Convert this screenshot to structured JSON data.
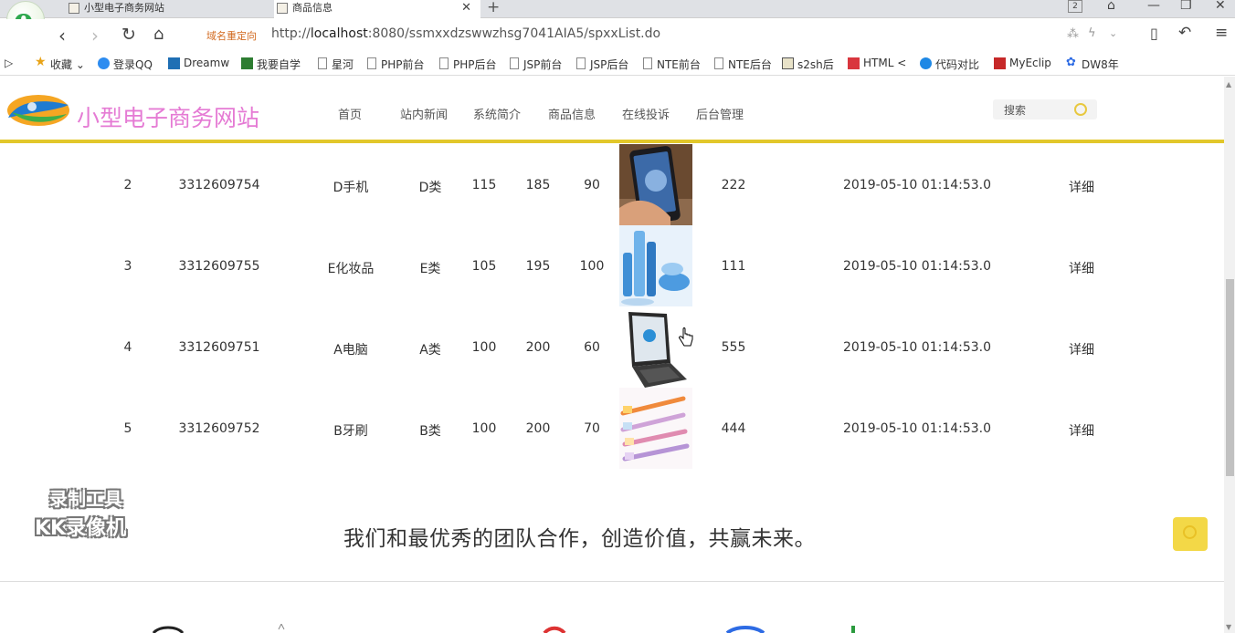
{
  "browser": {
    "tabs": [
      {
        "title": "小型电子商务网站",
        "active": false
      },
      {
        "title": "商品信息",
        "active": true
      }
    ],
    "tab_count_badge": "2",
    "redirect_label": "域名重定向",
    "url_prefix": "http://",
    "url_host": "localhost",
    "url_rest": ":8080/ssmxxdzswwzhsg7041AIA5/spxxList.do",
    "bookmarks": [
      "收藏",
      "登录QQ",
      "Dreamw",
      "我要自学",
      "星河",
      "PHP前台",
      "PHP后台",
      "JSP前台",
      "JSP后台",
      "NTE前台",
      "NTE后台",
      "s2sh后",
      "HTML <",
      "代码对比",
      "MyEclip",
      "DW8年"
    ]
  },
  "site": {
    "title": "小型电子商务网站",
    "menu": [
      "首页",
      "站内新闻",
      "系统简介",
      "商品信息",
      "在线投诉",
      "后台管理"
    ],
    "search_placeholder": "搜索",
    "accent_color": "#e2c72a",
    "title_color": "#e57bd4"
  },
  "products": [
    {
      "no": "2",
      "code": "3312609754",
      "name": "D手机",
      "category": "D类",
      "price1": "115",
      "price2": "185",
      "qty": "90",
      "image": "phone",
      "sales": "222",
      "time": "2019-05-10 01:14:53.0",
      "action": "详细"
    },
    {
      "no": "3",
      "code": "3312609755",
      "name": "E化妆品",
      "category": "E类",
      "price1": "105",
      "price2": "195",
      "qty": "100",
      "image": "cosmetics",
      "sales": "111",
      "time": "2019-05-10 01:14:53.0",
      "action": "详细"
    },
    {
      "no": "4",
      "code": "3312609751",
      "name": "A电脑",
      "category": "A类",
      "price1": "100",
      "price2": "200",
      "qty": "60",
      "image": "laptop",
      "sales": "555",
      "time": "2019-05-10 01:14:53.0",
      "action": "详细"
    },
    {
      "no": "5",
      "code": "3312609752",
      "name": "B牙刷",
      "category": "B类",
      "price1": "100",
      "price2": "200",
      "qty": "70",
      "image": "toothbrush",
      "sales": "444",
      "time": "2019-05-10 01:14:53.0",
      "action": "详细"
    }
  ],
  "footer": {
    "slogan": "我们和最优秀的团队合作，创造价值，共赢未来。"
  },
  "watermark": {
    "line1": "录制工具",
    "line2": "KK录像机"
  }
}
